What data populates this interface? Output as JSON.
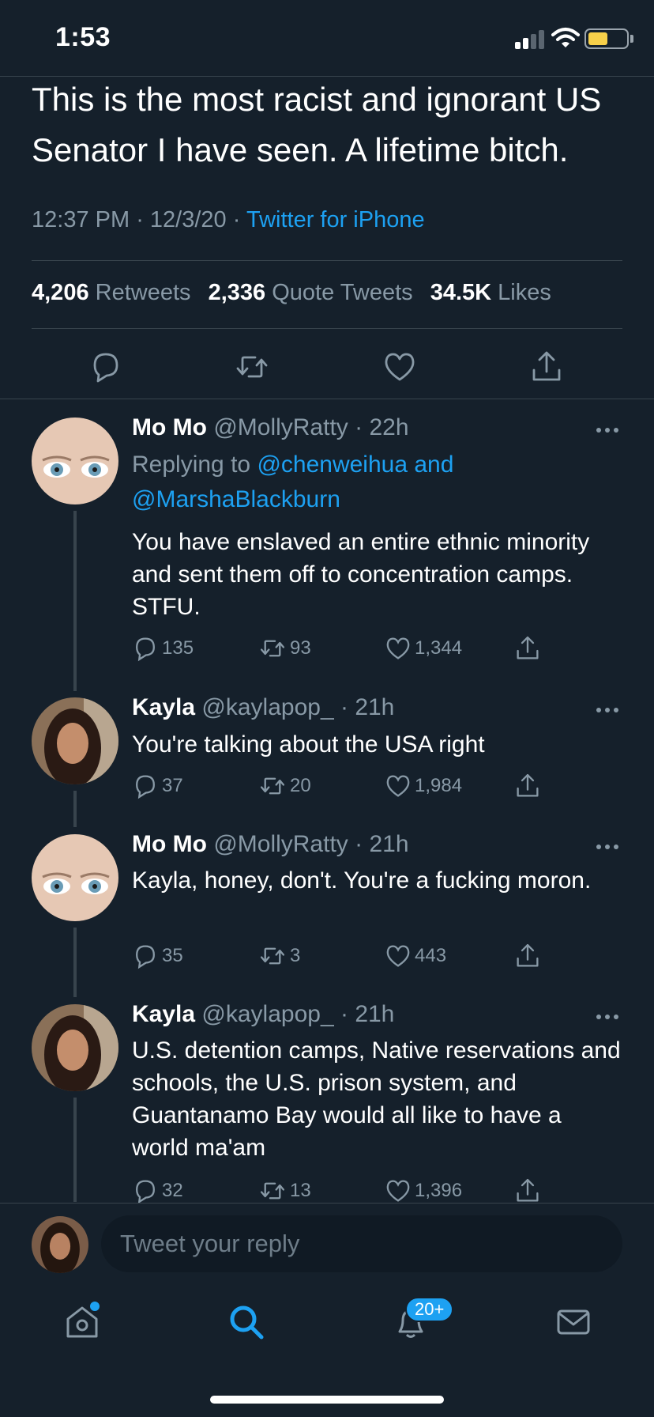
{
  "status_bar": {
    "time": "1:53"
  },
  "main_tweet": {
    "text": "This is the most racist and ignorant US Senator I have seen.  A lifetime bitch.",
    "time": "12:37 PM",
    "date": "12/3/20",
    "source": "Twitter for iPhone",
    "retweets_count": "4,206",
    "retweets_label": "Retweets",
    "quotes_count": "2,336",
    "quotes_label": "Quote Tweets",
    "likes_count": "34.5K",
    "likes_label": "Likes"
  },
  "replies": [
    {
      "name": "Mo Mo",
      "handle": "@MollyRatty",
      "time": "22h",
      "replying_prefix": "Replying to",
      "replying_to": "@chenweihua and @MarshaBlackburn",
      "text": "You have enslaved an entire ethnic minority and sent them off to concentration camps. STFU.",
      "reply_count": "135",
      "retweet_count": "93",
      "like_count": "1,344"
    },
    {
      "name": "Kayla",
      "handle": "@kaylapop_",
      "time": "21h",
      "text": "You're talking about the USA right",
      "reply_count": "37",
      "retweet_count": "20",
      "like_count": "1,984"
    },
    {
      "name": "Mo Mo",
      "handle": "@MollyRatty",
      "time": "21h",
      "text": "Kayla, honey, don't. You're a fucking moron.",
      "reply_count": "35",
      "retweet_count": "3",
      "like_count": "443"
    },
    {
      "name": "Kayla",
      "handle": "@kaylapop_",
      "time": "21h",
      "text": "U.S. detention camps, Native reservations and schools, the U.S. prison system, and Guantanamo Bay would all like to have a world ma'am",
      "reply_count": "32",
      "retweet_count": "13",
      "like_count": "1,396"
    }
  ],
  "composer": {
    "placeholder": "Tweet your reply"
  },
  "tab_bar": {
    "notifications_badge": "20+"
  },
  "icons": {
    "action_bar": [
      "reply-icon",
      "retweet-icon",
      "like-icon",
      "share-icon"
    ],
    "tab_bar": [
      "home-icon",
      "search-icon",
      "notifications-icon",
      "messages-icon"
    ]
  },
  "colors": {
    "background": "#15202b",
    "accent": "#1da1f2",
    "secondary_text": "#8899a6",
    "divider": "#38444d",
    "battery": "#f7d04a"
  }
}
